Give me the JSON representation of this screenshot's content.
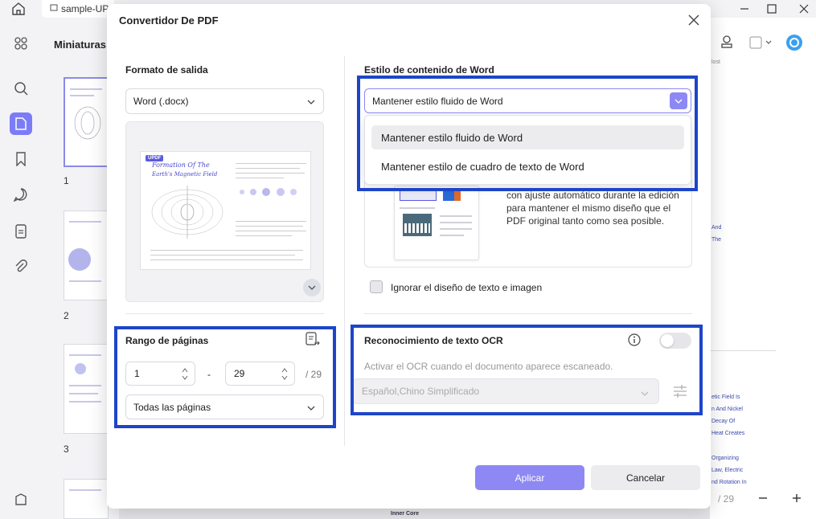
{
  "app": {
    "tab_title": "sample-UP",
    "thumbs_title": "Miniaturas",
    "thumb_numbers": [
      "1",
      "2",
      "3"
    ],
    "page_indicator": "/ 29",
    "right_snippets": [
      "lost",
      "And",
      "The",
      "etic Field Is",
      "n And Nickel",
      "Decay Of",
      "Heat Creates",
      "Organizing",
      "Law, Electric",
      "nd Rotation In"
    ],
    "bottom_text": "Inner Core"
  },
  "dialog": {
    "title": "Convertidor De PDF",
    "output_format": {
      "label": "Formato de salida",
      "value": "Word (.docx)"
    },
    "preview": {
      "logo": "UPDF",
      "title_line1": "Formation Of The",
      "title_line2": "Earth's Magnetic Field"
    },
    "page_range": {
      "label": "Rango de páginas",
      "from": "1",
      "separator": "-",
      "to": "29",
      "total": "/ 29",
      "mode": "Todas las páginas"
    },
    "word_style": {
      "label": "Estilo de contenido de Word",
      "selected": "Mantener estilo fluido de Word",
      "options": [
        "Mantener estilo fluido de Word",
        "Mantener estilo de cuadro de texto de Word"
      ],
      "description": "con ajuste automático durante la edición para mantener el mismo diseño que el PDF original tanto como sea posible."
    },
    "ignore_layout": {
      "label": "Ignorar el diseño de texto e imagen",
      "checked": false
    },
    "ocr": {
      "label": "Reconocimiento de texto OCR",
      "description": "Activar el OCR cuando el documento aparece escaneado.",
      "language": "Español,Chino Simplificado",
      "enabled": false
    },
    "buttons": {
      "apply": "Aplicar",
      "cancel": "Cancelar"
    }
  },
  "colors": {
    "accent": "#8e88f4",
    "highlight": "#1e45c8",
    "rail_active": "#7c7cf8"
  }
}
